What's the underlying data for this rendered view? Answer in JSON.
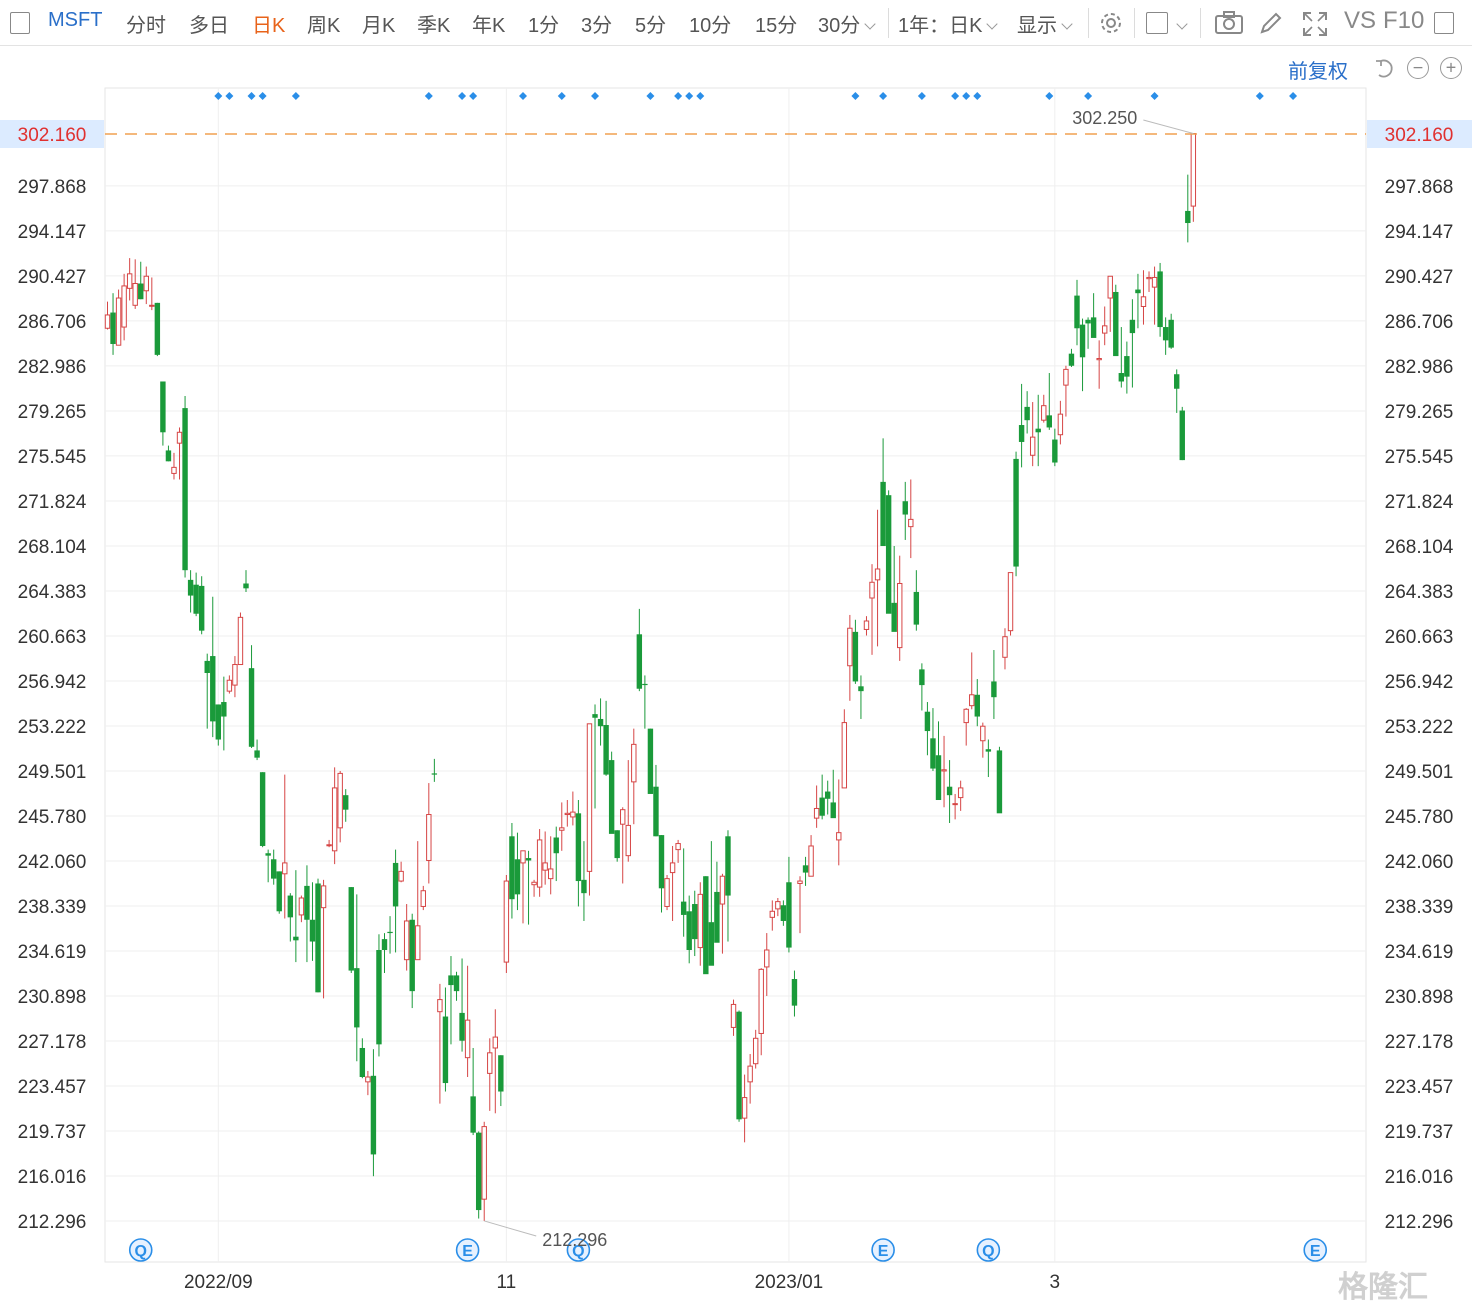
{
  "toolbar": {
    "symbol": "MSFT",
    "periods": [
      "分时",
      "多日",
      "日K",
      "周K",
      "月K",
      "季K",
      "年K",
      "1分",
      "3分",
      "5分",
      "10分",
      "15分",
      "30分"
    ],
    "active_period": "日K",
    "range_select": "1年：日K",
    "display_select": "显示",
    "vs_label": "VS",
    "f10_label": "F10"
  },
  "subbar": {
    "adjust_label": "前复权"
  },
  "watermark": "格隆汇",
  "colors": {
    "up": "#d64545",
    "down": "#1a9a3a",
    "accent": "#2a6fc9",
    "price_line": "#f0a050",
    "marker": "#2a8ee8",
    "price_label_bg": "#dcebff",
    "price_label_text": "#e0302f"
  },
  "chart_data": {
    "type": "candlestick",
    "symbol": "MSFT",
    "x_labels": [
      {
        "label": "2022/09",
        "index": 20
      },
      {
        "label": "11",
        "index": 72
      },
      {
        "label": "2023/01",
        "index": 123
      },
      {
        "label": "3",
        "index": 171
      }
    ],
    "y_ticks": [
      302.16,
      297.868,
      294.147,
      290.427,
      286.706,
      282.986,
      279.265,
      275.545,
      271.824,
      268.104,
      264.383,
      260.663,
      256.942,
      253.222,
      249.501,
      245.78,
      242.06,
      238.339,
      234.619,
      230.898,
      227.178,
      223.457,
      219.737,
      216.016,
      212.296
    ],
    "ylim": [
      211.4,
      303.4
    ],
    "current_price": "302.160",
    "max_label": "302.250",
    "min_label": "212.296",
    "event_icons": [
      {
        "type": "Q",
        "index": 6
      },
      {
        "type": "E",
        "index": 65
      },
      {
        "type": "Q",
        "index": 85
      },
      {
        "type": "E",
        "index": 140
      },
      {
        "type": "Q",
        "index": 159
      },
      {
        "type": "E",
        "index": 218
      }
    ],
    "marker_indices": [
      20,
      22,
      26,
      28,
      34,
      58,
      64,
      66,
      75,
      82,
      88,
      98,
      103,
      105,
      107,
      135,
      140,
      147,
      153,
      155,
      157,
      170,
      177,
      189,
      208,
      214
    ],
    "candles": [
      [
        286.1,
        288.3,
        286.0,
        287.2
      ],
      [
        287.4,
        289.0,
        283.9,
        284.8
      ],
      [
        284.7,
        289.3,
        284.7,
        288.6
      ],
      [
        286.2,
        290.6,
        285.1,
        289.6
      ],
      [
        289.4,
        291.9,
        288.4,
        290.6
      ],
      [
        288.0,
        291.8,
        287.7,
        289.8
      ],
      [
        289.8,
        291.6,
        288.5,
        288.5
      ],
      [
        289.2,
        291.2,
        288.1,
        290.4
      ],
      [
        288.0,
        290.3,
        287.6,
        288.0
      ],
      [
        288.2,
        288.2,
        283.8,
        283.9
      ],
      [
        281.7,
        281.7,
        276.4,
        277.5
      ],
      [
        276.0,
        276.4,
        275.1,
        275.1
      ],
      [
        274.1,
        275.8,
        273.6,
        274.6
      ],
      [
        276.6,
        277.9,
        273.6,
        277.5
      ],
      [
        279.5,
        280.5,
        265.5,
        266.1
      ],
      [
        265.3,
        266.1,
        262.6,
        264.0
      ],
      [
        264.9,
        265.9,
        262.3,
        262.5
      ],
      [
        264.8,
        265.6,
        260.8,
        261.1
      ],
      [
        258.6,
        259.2,
        253.0,
        257.6
      ],
      [
        259.0,
        263.9,
        252.3,
        253.6
      ],
      [
        255.0,
        255.0,
        251.6,
        252.1
      ],
      [
        255.2,
        257.3,
        251.2,
        254.0
      ],
      [
        256.1,
        257.4,
        255.9,
        257.0
      ],
      [
        256.6,
        259.0,
        255.6,
        258.3
      ],
      [
        258.3,
        262.6,
        258.3,
        262.2
      ],
      [
        265.0,
        266.1,
        264.3,
        264.6
      ],
      [
        258.0,
        259.9,
        251.4,
        251.5
      ],
      [
        251.2,
        252.1,
        250.4,
        250.6
      ],
      [
        249.4,
        249.4,
        243.2,
        243.3
      ],
      [
        242.7,
        243.0,
        240.3,
        242.5
      ],
      [
        242.2,
        243.0,
        240.1,
        240.6
      ],
      [
        241.2,
        241.2,
        237.7,
        237.9
      ],
      [
        241.0,
        249.2,
        237.3,
        241.9
      ],
      [
        239.2,
        239.4,
        235.4,
        237.4
      ],
      [
        235.8,
        241.3,
        233.7,
        235.5
      ],
      [
        237.6,
        239.2,
        237.0,
        239.0
      ],
      [
        240.0,
        241.7,
        233.7,
        237.2
      ],
      [
        237.2,
        240.3,
        233.8,
        235.4
      ],
      [
        240.2,
        240.6,
        231.2,
        231.2
      ],
      [
        238.2,
        240.5,
        230.7,
        240.0
      ],
      [
        243.4,
        243.8,
        243.2,
        243.4
      ],
      [
        242.9,
        249.8,
        241.8,
        248.1
      ],
      [
        244.8,
        249.5,
        243.6,
        249.3
      ],
      [
        247.5,
        248.0,
        245.3,
        246.3
      ],
      [
        239.9,
        239.9,
        232.8,
        233.0
      ],
      [
        233.2,
        239.3,
        225.5,
        228.3
      ],
      [
        226.6,
        227.4,
        224.1,
        224.2
      ],
      [
        223.8,
        224.7,
        222.7,
        224.2
      ],
      [
        224.3,
        226.5,
        216.0,
        217.8
      ],
      [
        234.7,
        236.0,
        225.9,
        226.9
      ],
      [
        235.6,
        236.1,
        232.8,
        234.7
      ],
      [
        236.2,
        237.5,
        234.4,
        236.1
      ],
      [
        241.9,
        243.0,
        234.5,
        238.3
      ],
      [
        240.4,
        242.0,
        240.3,
        241.2
      ],
      [
        233.9,
        238.5,
        233.0,
        237.1
      ],
      [
        237.2,
        237.7,
        229.9,
        231.3
      ],
      [
        233.9,
        243.7,
        233.9,
        236.7
      ],
      [
        238.3,
        240.0,
        238.0,
        239.6
      ],
      [
        242.1,
        248.5,
        240.2,
        245.9
      ],
      [
        249.3,
        250.5,
        248.6,
        249.2
      ],
      [
        229.6,
        231.9,
        222.0,
        230.6
      ],
      [
        229.2,
        231.6,
        223.0,
        223.7
      ],
      [
        232.6,
        234.2,
        226.9,
        231.8
      ],
      [
        232.6,
        232.9,
        230.5,
        231.3
      ],
      [
        229.5,
        234.0,
        226.3,
        227.2
      ],
      [
        225.8,
        233.4,
        224.2,
        228.9
      ],
      [
        222.6,
        226.6,
        219.4,
        219.6
      ],
      [
        219.6,
        219.7,
        212.5,
        213.2
      ],
      [
        214.1,
        220.5,
        212.3,
        220.1
      ],
      [
        224.5,
        227.4,
        221.4,
        226.2
      ],
      [
        226.6,
        229.8,
        221.2,
        227.5
      ],
      [
        226.0,
        226.0,
        221.8,
        223.0
      ],
      [
        233.7,
        240.9,
        232.8,
        240.4
      ],
      [
        244.1,
        245.2,
        237.3,
        238.9
      ],
      [
        242.2,
        244.4,
        238.0,
        239.3
      ],
      [
        241.9,
        242.4,
        236.9,
        242.9
      ],
      [
        242.3,
        242.9,
        236.8,
        242.1
      ],
      [
        240.1,
        240.5,
        239.1,
        240.3
      ],
      [
        239.9,
        244.7,
        239.1,
        243.8
      ],
      [
        241.3,
        244.5,
        240.1,
        241.9
      ],
      [
        240.6,
        244.1,
        239.3,
        241.4
      ],
      [
        244.0,
        244.9,
        240.4,
        242.7
      ],
      [
        244.6,
        246.9,
        242.9,
        244.8
      ],
      [
        245.9,
        247.1,
        244.9,
        246.0
      ],
      [
        245.7,
        247.8,
        245.0,
        246.1
      ],
      [
        246.0,
        247.1,
        238.3,
        240.4
      ],
      [
        240.5,
        243.7,
        237.1,
        239.4
      ],
      [
        241.2,
        247.2,
        239.2,
        253.4
      ],
      [
        254.2,
        255.0,
        246.4,
        253.9
      ],
      [
        253.8,
        255.5,
        251.6,
        253.2
      ],
      [
        253.3,
        255.3,
        249.1,
        249.2
      ],
      [
        250.4,
        251.1,
        246.6,
        244.3
      ],
      [
        244.6,
        244.6,
        242.0,
        242.3
      ],
      [
        245.1,
        246.5,
        240.2,
        246.3
      ],
      [
        242.5,
        250.4,
        242.0,
        245.0
      ],
      [
        248.6,
        253.0,
        245.1,
        251.7
      ],
      [
        260.8,
        262.9,
        256.1,
        256.3
      ],
      [
        256.7,
        257.4,
        253.0,
        256.6
      ],
      [
        253.0,
        253.0,
        248.6,
        247.6
      ],
      [
        248.2,
        250.0,
        244.1,
        244.1
      ],
      [
        244.2,
        244.2,
        237.8,
        239.8
      ],
      [
        238.3,
        240.9,
        238.0,
        240.6
      ],
      [
        241.1,
        243.3,
        237.1,
        241.9
      ],
      [
        243.0,
        243.8,
        241.9,
        243.5
      ],
      [
        238.7,
        243.1,
        235.8,
        237.6
      ],
      [
        237.9,
        239.2,
        233.6,
        234.7
      ],
      [
        238.5,
        239.6,
        234.2,
        235.6
      ],
      [
        234.9,
        240.3,
        233.4,
        239.3
      ],
      [
        240.8,
        240.8,
        235.7,
        232.7
      ],
      [
        237.0,
        243.7,
        236.3,
        233.4
      ],
      [
        239.5,
        242.0,
        236.8,
        235.3
      ],
      [
        238.5,
        241.0,
        234.4,
        240.8
      ],
      [
        244.1,
        244.6,
        235.4,
        239.2
      ],
      [
        228.3,
        230.6,
        227.6,
        230.2
      ],
      [
        229.6,
        229.7,
        220.5,
        220.7
      ],
      [
        220.8,
        224.4,
        218.8,
        222.5
      ],
      [
        223.8,
        226.1,
        222.0,
        225.1
      ],
      [
        225.3,
        228.1,
        224.9,
        227.4
      ],
      [
        227.8,
        233.2,
        226.0,
        233.1
      ],
      [
        233.3,
        236.1,
        230.9,
        234.7
      ],
      [
        237.4,
        238.8,
        236.3,
        237.9
      ],
      [
        238.1,
        239.0,
        237.5,
        238.7
      ],
      [
        238.4,
        238.8,
        236.7,
        237.1
      ],
      [
        240.3,
        242.4,
        234.5,
        234.9
      ],
      [
        232.3,
        233.0,
        229.2,
        230.1
      ],
      [
        240.2,
        240.8,
        236.1,
        240.4
      ],
      [
        241.7,
        242.4,
        240.0,
        241.1
      ],
      [
        240.8,
        244.2,
        242.2,
        243.3
      ],
      [
        245.6,
        248.3,
        244.8,
        246.4
      ],
      [
        247.3,
        249.2,
        245.5,
        245.8
      ],
      [
        247.8,
        248.7,
        245.9,
        247.2
      ],
      [
        246.9,
        249.6,
        245.9,
        245.6
      ],
      [
        243.8,
        248.8,
        241.7,
        244.4
      ],
      [
        248.1,
        254.6,
        248.1,
        253.5
      ],
      [
        258.2,
        262.4,
        255.3,
        261.3
      ],
      [
        261.0,
        262.0,
        256.7,
        256.9
      ],
      [
        256.5,
        257.4,
        253.8,
        256.1
      ],
      [
        261.2,
        262.3,
        260.7,
        261.9
      ],
      [
        263.8,
        266.6,
        259.1,
        265.1
      ],
      [
        265.3,
        271.1,
        259.8,
        266.2
      ],
      [
        273.4,
        277.0,
        268.9,
        268.1
      ],
      [
        272.3,
        272.7,
        264.9,
        262.5
      ],
      [
        263.4,
        268.1,
        261.7,
        261.0
      ],
      [
        259.7,
        267.3,
        258.6,
        265.0
      ],
      [
        271.8,
        273.4,
        268.6,
        270.7
      ],
      [
        269.7,
        273.6,
        267.1,
        270.3
      ],
      [
        264.3,
        266.1,
        261.1,
        261.6
      ],
      [
        257.9,
        258.4,
        254.5,
        256.6
      ],
      [
        254.4,
        255.2,
        250.8,
        252.8
      ],
      [
        252.2,
        254.7,
        249.5,
        249.7
      ],
      [
        250.8,
        253.6,
        247.7,
        247.1
      ],
      [
        249.5,
        252.4,
        246.5,
        249.6
      ],
      [
        248.2,
        250.4,
        245.2,
        247.5
      ],
      [
        246.8,
        247.6,
        245.5,
        246.8
      ],
      [
        247.3,
        248.7,
        246.2,
        248.1
      ],
      [
        253.5,
        254.7,
        251.6,
        254.6
      ],
      [
        254.9,
        259.3,
        254.6,
        255.8
      ],
      [
        255.8,
        257.1,
        253.2,
        254.0
      ],
      [
        252.0,
        253.5,
        250.6,
        253.2
      ],
      [
        251.3,
        252.1,
        249.0,
        251.1
      ],
      [
        256.9,
        259.5,
        253.8,
        255.6
      ],
      [
        251.2,
        251.5,
        246.8,
        246.0
      ],
      [
        258.9,
        261.3,
        257.9,
        260.6
      ],
      [
        261.1,
        265.9,
        260.7,
        265.9
      ],
      [
        275.3,
        275.9,
        265.6,
        266.4
      ],
      [
        278.1,
        281.5,
        274.6,
        276.7
      ],
      [
        279.6,
        280.9,
        277.4,
        278.5
      ],
      [
        275.6,
        280.0,
        274.7,
        277.1
      ],
      [
        277.8,
        280.6,
        274.7,
        277.5
      ],
      [
        278.5,
        280.6,
        278.3,
        279.7
      ],
      [
        278.9,
        282.4,
        277.7,
        277.9
      ],
      [
        276.9,
        277.8,
        274.7,
        275.0
      ],
      [
        277.3,
        280.1,
        276.5,
        279.0
      ],
      [
        281.4,
        283.0,
        278.8,
        282.7
      ],
      [
        284.0,
        284.4,
        282.9,
        283.0
      ],
      [
        288.8,
        290.1,
        284.7,
        286.1
      ],
      [
        286.4,
        286.9,
        280.9,
        283.7
      ],
      [
        286.8,
        287.0,
        284.4,
        286.5
      ],
      [
        287.0,
        289.0,
        285.4,
        285.3
      ],
      [
        283.5,
        285.1,
        281.1,
        283.6
      ],
      [
        285.7,
        287.9,
        284.7,
        286.3
      ],
      [
        288.6,
        290.1,
        285.8,
        290.4
      ],
      [
        289.1,
        289.7,
        284.6,
        283.8
      ],
      [
        282.4,
        286.2,
        281.2,
        281.7
      ],
      [
        283.8,
        285.0,
        280.7,
        282.1
      ],
      [
        286.8,
        288.5,
        281.2,
        285.7
      ],
      [
        289.3,
        290.6,
        286.1,
        289.0
      ],
      [
        287.9,
        290.9,
        286.4,
        288.7
      ],
      [
        290.2,
        290.8,
        289.1,
        290.3
      ],
      [
        289.5,
        291.2,
        286.4,
        290.3
      ],
      [
        290.8,
        291.5,
        285.4,
        286.2
      ],
      [
        286.2,
        287.0,
        283.9,
        285.1
      ],
      [
        286.8,
        287.3,
        284.4,
        284.5
      ],
      [
        282.3,
        282.7,
        279.1,
        281.1
      ],
      [
        279.3,
        279.6,
        275.2,
        275.2
      ],
      [
        295.8,
        298.8,
        293.2,
        294.8
      ],
      [
        296.2,
        302.2,
        294.9,
        302.2
      ]
    ]
  }
}
